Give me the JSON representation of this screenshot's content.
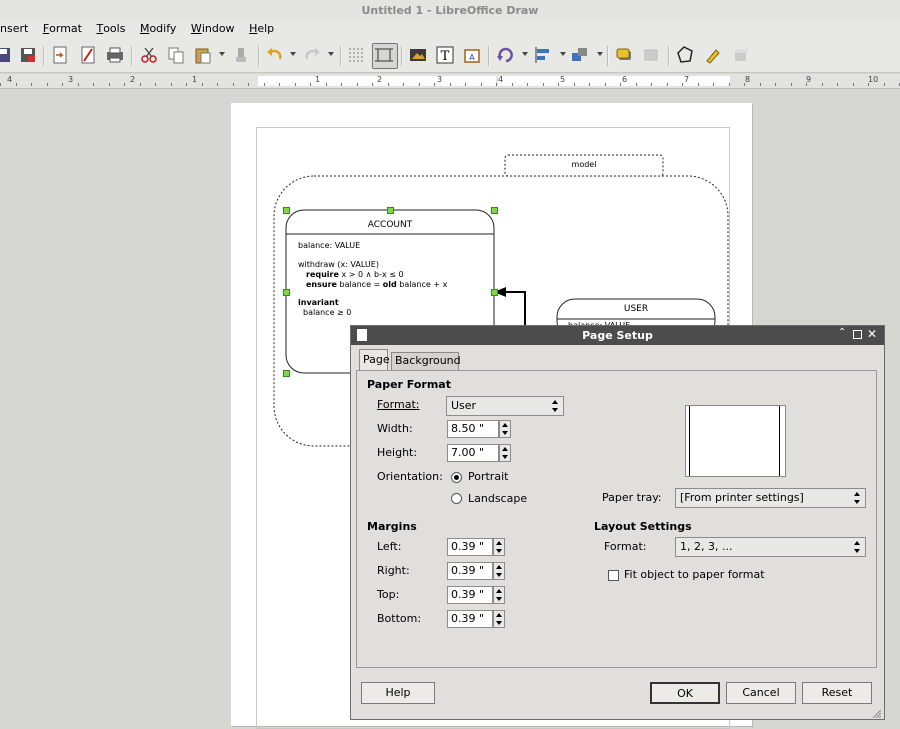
{
  "window": {
    "title": "Untitled 1 - LibreOffice Draw"
  },
  "menu": {
    "items": [
      "nsert",
      "Format",
      "Tools",
      "Modify",
      "Window",
      "Help"
    ]
  },
  "toolbar": {
    "icons": [
      "save-icon",
      "save-as-icon",
      "export-icon",
      "export-pdf-icon",
      "print-icon",
      "cut-icon",
      "copy-icon",
      "paste-icon",
      "clone-format-icon",
      "undo-icon",
      "redo-icon",
      "grid-icon",
      "helplines-icon",
      "image-icon",
      "text-icon",
      "fontwork-icon",
      "rotate-icon",
      "align-icon",
      "arrange-icon",
      "shadow-icon",
      "crop-icon",
      "points-icon",
      "glue-points-icon",
      "extrusion-icon"
    ]
  },
  "ruler": {
    "numbers": [
      "4",
      "3",
      "2",
      "1",
      "1",
      "2",
      "3",
      "4",
      "5",
      "6",
      "7",
      "8",
      "9",
      "10"
    ]
  },
  "diagram": {
    "model_label": "model",
    "account": {
      "title": "ACCOUNT",
      "line1": "balance: VALUE",
      "line2": "withdraw (x: VALUE)",
      "line3_kw": "require",
      "line3": " x > 0 ∧ b-x ≤ 0",
      "line4_kw": "ensure",
      "line4a": " balance = ",
      "line4_kw2": "old",
      "line4b": " balance + x",
      "line5": "invariant",
      "line6": "balance ≥ 0"
    },
    "user": {
      "title": "USER",
      "partial": "balance: VALUE"
    }
  },
  "dialog": {
    "title": "Page Setup",
    "tabs": [
      "Page",
      "Background"
    ],
    "paper_format": {
      "heading": "Paper Format",
      "format_label": "Format:",
      "format_value": "User",
      "width_label": "Width:",
      "width_value": "8.50 \"",
      "height_label": "Height:",
      "height_value": "7.00 \"",
      "orientation_label": "Orientation:",
      "portrait": "Portrait",
      "landscape": "Landscape",
      "orientation_selected": "Portrait",
      "paper_tray_label": "Paper tray:",
      "paper_tray_value": "[From printer settings]"
    },
    "margins": {
      "heading": "Margins",
      "left_label": "Left:",
      "left_value": "0.39 \"",
      "right_label": "Right:",
      "right_value": "0.39 \"",
      "top_label": "Top:",
      "top_value": "0.39 \"",
      "bottom_label": "Bottom:",
      "bottom_value": "0.39 \""
    },
    "layout": {
      "heading": "Layout Settings",
      "format_label": "Format:",
      "format_value": "1, 2, 3, ...",
      "fit_label": "Fit object to paper format",
      "fit_checked": false
    },
    "buttons": {
      "help": "Help",
      "ok": "OK",
      "cancel": "Cancel",
      "reset": "Reset"
    }
  }
}
